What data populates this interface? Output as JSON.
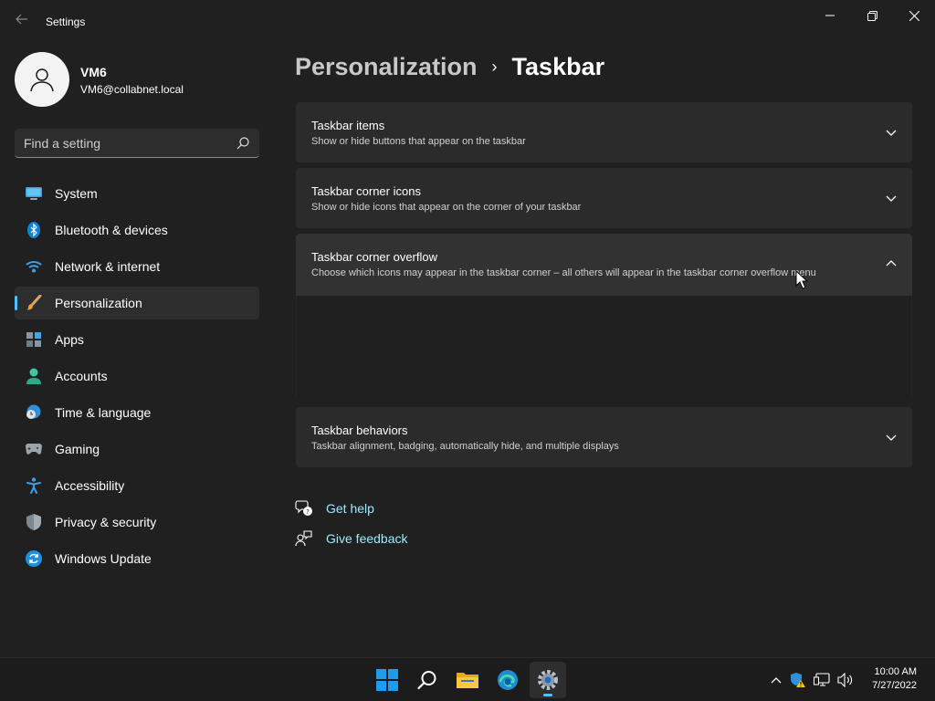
{
  "window": {
    "title": "Settings"
  },
  "profile": {
    "name": "VM6",
    "email": "VM6@collabnet.local"
  },
  "search": {
    "placeholder": "Find a setting"
  },
  "sidebar": {
    "items": [
      {
        "label": "System",
        "icon": "monitor-icon"
      },
      {
        "label": "Bluetooth & devices",
        "icon": "bluetooth-icon"
      },
      {
        "label": "Network & internet",
        "icon": "wifi-icon"
      },
      {
        "label": "Personalization",
        "icon": "paintbrush-icon",
        "active": true
      },
      {
        "label": "Apps",
        "icon": "apps-icon"
      },
      {
        "label": "Accounts",
        "icon": "person-icon"
      },
      {
        "label": "Time & language",
        "icon": "globe-clock-icon"
      },
      {
        "label": "Gaming",
        "icon": "gamepad-icon"
      },
      {
        "label": "Accessibility",
        "icon": "accessibility-icon"
      },
      {
        "label": "Privacy & security",
        "icon": "shield-icon"
      },
      {
        "label": "Windows Update",
        "icon": "update-icon"
      }
    ]
  },
  "breadcrumb": {
    "parent": "Personalization",
    "separator": "›",
    "current": "Taskbar"
  },
  "cards": [
    {
      "title": "Taskbar items",
      "description": "Show or hide buttons that appear on the taskbar",
      "expanded": false
    },
    {
      "title": "Taskbar corner icons",
      "description": "Show or hide icons that appear on the corner of your taskbar",
      "expanded": false
    },
    {
      "title": "Taskbar corner overflow",
      "description": "Choose which icons may appear in the taskbar corner – all others will appear in the taskbar corner overflow menu",
      "expanded": true
    },
    {
      "title": "Taskbar behaviors",
      "description": "Taskbar alignment, badging, automatically hide, and multiple displays",
      "expanded": false
    }
  ],
  "help": {
    "get_help": "Get help",
    "give_feedback": "Give feedback"
  },
  "taskbar": {
    "apps": [
      "start-icon",
      "search-icon",
      "file-explorer-icon",
      "edge-icon",
      "settings-icon"
    ],
    "active_app": "settings-icon",
    "tray": [
      "chevron-up-icon",
      "security-warning-icon",
      "network-icon",
      "volume-icon"
    ],
    "time": "10:00 AM",
    "date": "7/27/2022"
  },
  "colors": {
    "background": "#202020",
    "card": "#2b2b2b",
    "accent": "#4cc2ff",
    "link": "#99ebff"
  }
}
